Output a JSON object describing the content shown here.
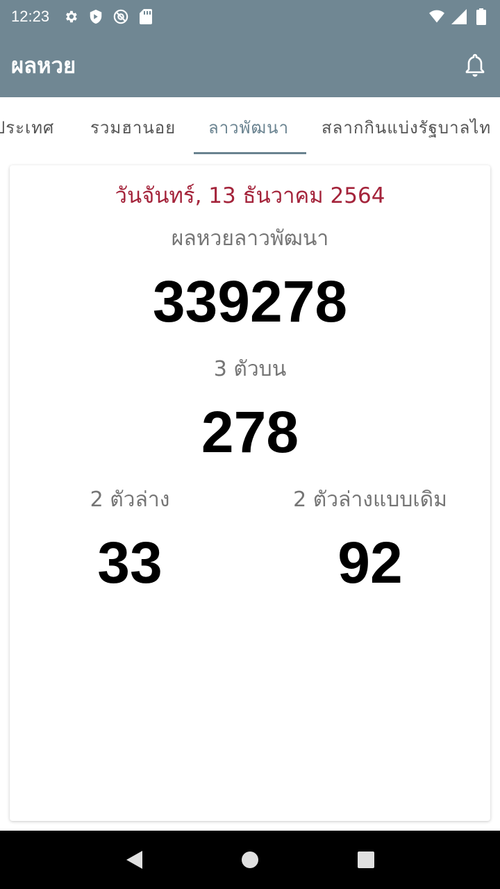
{
  "status_bar": {
    "time": "12:23",
    "icons": [
      "gear-icon",
      "shield-icon",
      "no-sim-icon",
      "sd-card-icon",
      "wifi-icon",
      "signal-icon",
      "battery-icon"
    ]
  },
  "app_bar": {
    "title": "ผลหวย",
    "notification_icon": "bell-icon"
  },
  "tabs": [
    {
      "label": "ประเทศ",
      "active": false
    },
    {
      "label": "รวมฮานอย",
      "active": false
    },
    {
      "label": "ลาวพัฒนา",
      "active": true
    },
    {
      "label": "สลากกินแบ่งรัฐบาลไท",
      "active": false
    }
  ],
  "result": {
    "date": "วันจันทร์, 13 ธันวาคม 2564",
    "title": "ผลหวยลาวพัฒนา",
    "main_number": "339278",
    "three_top_label": "3 ตัวบน",
    "three_top_number": "278",
    "two_bottom_label": "2 ตัวล่าง",
    "two_bottom_number": "33",
    "two_bottom_old_label": "2 ตัวล่างแบบเดิม",
    "two_bottom_old_number": "92"
  },
  "colors": {
    "app_bar": "#708793",
    "accent": "#6a8390",
    "date_text": "#a4243b"
  },
  "nav_bar": {
    "buttons": [
      "back-icon",
      "home-icon",
      "recents-icon"
    ]
  }
}
